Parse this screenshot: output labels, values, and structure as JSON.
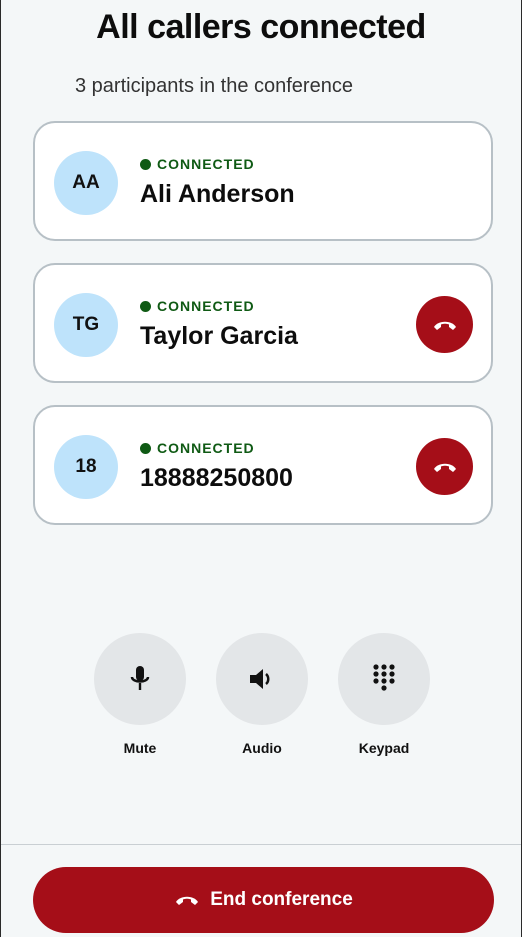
{
  "header": {
    "title": "All callers connected",
    "subtitle": "3 participants in the conference"
  },
  "participants": [
    {
      "initials": "AA",
      "status": "CONNECTED",
      "name": "Ali Anderson",
      "can_hang_up": false
    },
    {
      "initials": "TG",
      "status": "CONNECTED",
      "name": "Taylor Garcia",
      "can_hang_up": true
    },
    {
      "initials": "18",
      "status": "CONNECTED",
      "name": "18888250800",
      "can_hang_up": true
    }
  ],
  "controls": [
    {
      "label": "Mute",
      "icon": "microphone-icon"
    },
    {
      "label": "Audio",
      "icon": "speaker-icon"
    },
    {
      "label": "Keypad",
      "icon": "keypad-icon"
    }
  ],
  "footer": {
    "end_label": "End conference",
    "icon": "hangup-icon"
  },
  "colors": {
    "accent_red": "#a50e18",
    "status_green": "#0f5a14",
    "avatar_blue": "#bee3fb",
    "background": "#f4f7f8"
  }
}
